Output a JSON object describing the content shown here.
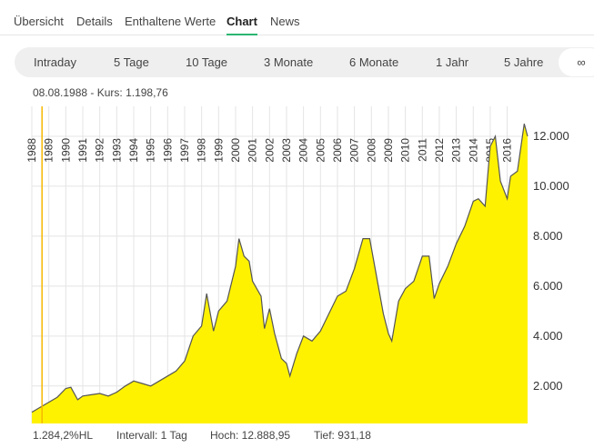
{
  "tabs": [
    {
      "label": "Übersicht",
      "active": false
    },
    {
      "label": "Details",
      "active": false
    },
    {
      "label": "Enthaltene Werte",
      "active": false
    },
    {
      "label": "Chart",
      "active": true
    },
    {
      "label": "News",
      "active": false
    }
  ],
  "ranges": [
    {
      "label": "Intraday",
      "active": false
    },
    {
      "label": "5 Tage",
      "active": false
    },
    {
      "label": "10 Tage",
      "active": false
    },
    {
      "label": "3 Monate",
      "active": false
    },
    {
      "label": "6 Monate",
      "active": false
    },
    {
      "label": "1 Jahr",
      "active": false
    },
    {
      "label": "5 Jahre",
      "active": false
    },
    {
      "label": "∞",
      "active": true
    }
  ],
  "info": {
    "text": "08.08.1988  -  Kurs: 1.198,76"
  },
  "footer": {
    "perf": "1.284,2%HL",
    "interval": "Intervall: 1 Tag",
    "high": "Hoch:  12.888,95",
    "low": "Tief:   931,18"
  },
  "colors": {
    "fill": "#fff200",
    "line": "#555555",
    "grid": "#e4e4e4",
    "crosshair": "#f5b800"
  },
  "chart_data": {
    "type": "area",
    "x_tick_labels": [
      "1988",
      "1989",
      "1990",
      "1991",
      "1992",
      "1993",
      "1994",
      "1995",
      "1996",
      "1997",
      "1998",
      "1999",
      "2000",
      "2001",
      "2002",
      "2003",
      "2004",
      "2005",
      "2006",
      "2007",
      "2008",
      "2009",
      "2010",
      "2011",
      "2012",
      "2013",
      "2014",
      "2015",
      "2016"
    ],
    "y_tick_labels": [
      "2.000",
      "4.000",
      "6.000",
      "8.000",
      "10.000",
      "12.000"
    ],
    "y_ticks": [
      2000,
      4000,
      6000,
      8000,
      10000,
      12000
    ],
    "ylim": [
      500,
      13200
    ],
    "xlim": [
      1988.0,
      2017.2
    ],
    "crosshair_x": 1988.6,
    "x": [
      1988.0,
      1988.5,
      1989.0,
      1989.5,
      1990.0,
      1990.3,
      1990.7,
      1991.0,
      1991.5,
      1992.0,
      1992.5,
      1993.0,
      1993.5,
      1994.0,
      1994.5,
      1995.0,
      1995.5,
      1996.0,
      1996.5,
      1997.0,
      1997.5,
      1998.0,
      1998.3,
      1998.7,
      1999.0,
      1999.5,
      2000.0,
      2000.2,
      2000.5,
      2000.8,
      2001.0,
      2001.5,
      2001.7,
      2002.0,
      2002.3,
      2002.7,
      2003.0,
      2003.2,
      2003.6,
      2004.0,
      2004.5,
      2005.0,
      2005.5,
      2006.0,
      2006.5,
      2007.0,
      2007.5,
      2007.9,
      2008.3,
      2008.7,
      2009.0,
      2009.2,
      2009.6,
      2010.0,
      2010.5,
      2011.0,
      2011.4,
      2011.7,
      2012.0,
      2012.5,
      2013.0,
      2013.5,
      2014.0,
      2014.3,
      2014.7,
      2015.0,
      2015.3,
      2015.6,
      2016.0,
      2016.2,
      2016.6,
      2017.0,
      2017.2
    ],
    "y": [
      950,
      1150,
      1350,
      1550,
      1900,
      1950,
      1450,
      1600,
      1650,
      1700,
      1600,
      1750,
      2000,
      2200,
      2100,
      2000,
      2200,
      2400,
      2600,
      3000,
      4000,
      4400,
      5700,
      4200,
      5000,
      5400,
      6800,
      7900,
      7200,
      7000,
      6200,
      5600,
      4300,
      5100,
      4100,
      3100,
      2900,
      2400,
      3300,
      4000,
      3800,
      4200,
      4900,
      5600,
      5800,
      6700,
      7900,
      7900,
      6400,
      4900,
      4100,
      3800,
      5400,
      5900,
      6200,
      7200,
      7200,
      5500,
      6100,
      6800,
      7700,
      8400,
      9400,
      9500,
      9200,
      11600,
      12000,
      10200,
      9500,
      10400,
      10600,
      12500,
      12000
    ]
  }
}
